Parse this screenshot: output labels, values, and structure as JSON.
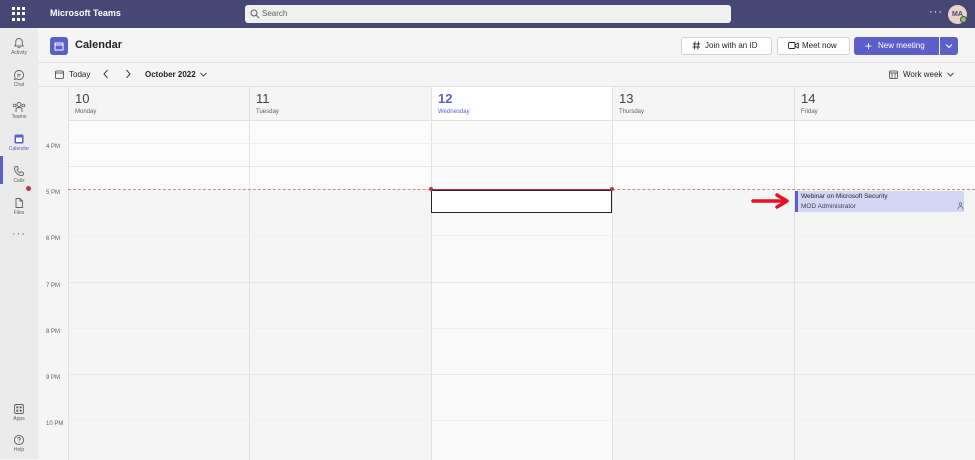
{
  "app": {
    "name": "Microsoft Teams",
    "avatar_initials": "MA"
  },
  "search": {
    "placeholder": "Search"
  },
  "rail": {
    "items": [
      {
        "label": "Activity"
      },
      {
        "label": "Chat"
      },
      {
        "label": "Teams"
      },
      {
        "label": "Calendar"
      },
      {
        "label": "Calls"
      },
      {
        "label": "Files"
      },
      {
        "label": "Apps"
      },
      {
        "label": "Help"
      }
    ]
  },
  "header": {
    "title": "Calendar",
    "join_label": "Join with an ID",
    "meet_label": "Meet now",
    "new_meeting_label": "New meeting"
  },
  "toolbar": {
    "today_label": "Today",
    "month_label": "October 2022",
    "view_label": "Work week"
  },
  "days": [
    {
      "num": "10",
      "name": "Monday"
    },
    {
      "num": "11",
      "name": "Tuesday"
    },
    {
      "num": "12",
      "name": "Wednesday"
    },
    {
      "num": "13",
      "name": "Thursday"
    },
    {
      "num": "14",
      "name": "Friday"
    }
  ],
  "times": [
    "4 PM",
    "5 PM",
    "6 PM",
    "7 PM",
    "8 PM",
    "9 PM",
    "10 PM"
  ],
  "event": {
    "title": "Webinar on Microsoft Security",
    "organizer": "MOD Administrator"
  },
  "colors": {
    "brand": "#464775",
    "accent": "#5b5fc7",
    "now": "#c4314b",
    "event_bg": "#d4d6f6",
    "arrow": "#e81123"
  }
}
